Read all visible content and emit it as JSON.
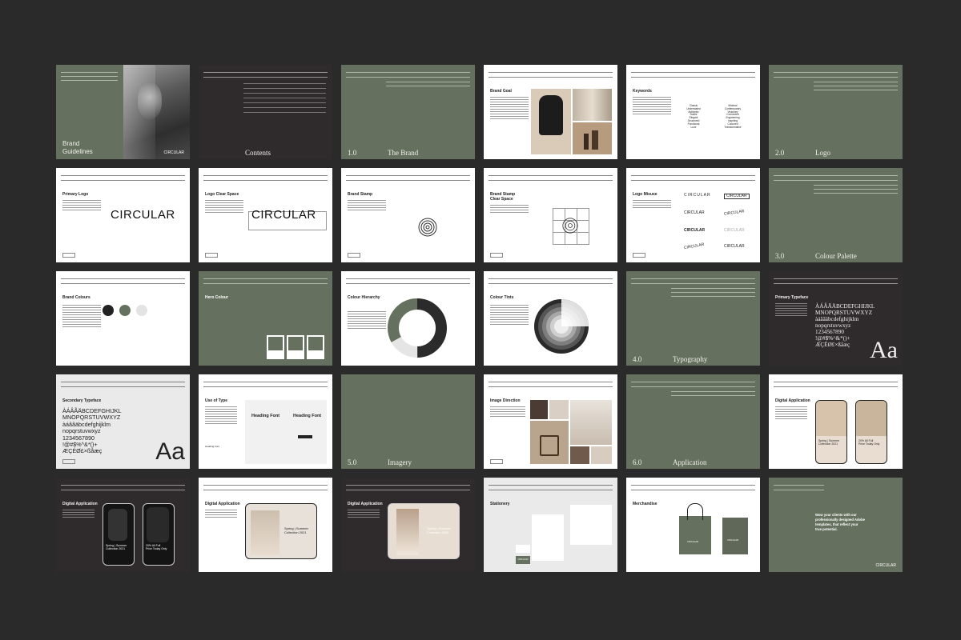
{
  "slides": {
    "cover": {
      "title_line1": "Brand",
      "title_line2": "Guidelines",
      "logo": "CIRCULAR"
    },
    "contents": {
      "title": "Contents"
    },
    "brand": {
      "num": "1.0",
      "name": "The Brand"
    },
    "brand_goal": {
      "title": "Brand Goal"
    },
    "keywords": {
      "title": "Keywords",
      "col1": "Classic\nUnderstated\nAuthentic\nSubtle\nElegant\nStructured\nFunctional\nLuxe",
      "col2": "Minimal\nContemporary\nVisionary\nConnected\nEngineering\nInspiring\nColoured\nTransformative"
    },
    "logo_section": {
      "num": "2.0",
      "name": "Logo"
    },
    "primary_logo": {
      "title": "Primary Logo",
      "logo": "CIRCULAR"
    },
    "logo_clear_space": {
      "title": "Logo Clear Space",
      "logo": "CIRCULAR"
    },
    "brand_stamp": {
      "title": "Brand Stamp"
    },
    "brand_stamp_clear": {
      "title_line1": "Brand Stamp",
      "title_line2": "Clear Space"
    },
    "logo_misuse": {
      "title": "Logo Misuse",
      "logo": "CIRCULAR"
    },
    "palette_section": {
      "num": "3.0",
      "name": "Colour Palette"
    },
    "brand_colours": {
      "title": "Brand Colours"
    },
    "hero_colour": {
      "title": "Hero Colour"
    },
    "colour_hierarchy": {
      "title": "Colour Hierarchy"
    },
    "colour_tints": {
      "title": "Colour Tints"
    },
    "typography_section": {
      "num": "4.0",
      "name": "Typography"
    },
    "primary_typeface": {
      "title": "Primary Typeface",
      "glyphs": "ÀÁÂÃÄBCDEFGHIJKL\nMNOPQRSTUVWXYZ\nàáâãäbcdefghijklm\nnopqrstuvwxyz\n1234567890\n!@#$%^&*()+\nÆÇÉØ£×ßåæç",
      "aa": "Aa"
    },
    "secondary_typeface": {
      "title": "Secondary Typeface",
      "glyphs": "ÀÁÂÃÄBCDEFGHIJKL\nMNOPQRSTUVWXYZ\nàáâãäbcdefghijklm\nnopqrstuvwxyz\n1234567890\n!@#$%^&*()+\nÆÇÉØ£×ßåæç",
      "aa": "Aa"
    },
    "use_of_type": {
      "title": "Use of Type",
      "heading1": "Heading Font",
      "heading2": "Heading Font",
      "label": "Heading Font"
    },
    "imagery_section": {
      "num": "5.0",
      "name": "Imagery"
    },
    "image_direction": {
      "title": "Image Direction"
    },
    "application_section": {
      "num": "6.0",
      "name": "Application"
    },
    "digital_app_1": {
      "title": "Digital Application",
      "promo1": "Spring | Summer\nCollection 2021",
      "promo2": "20% All Full\nPrice Today Only"
    },
    "digital_app_2": {
      "title": "Digital Application",
      "promo1": "Spring | Summer\nCollection 2021",
      "promo2": "20% All Full\nPrice Today Only"
    },
    "digital_app_3": {
      "title": "Digital Application",
      "promo": "Spring | Summer\nCollection 2021"
    },
    "digital_app_4": {
      "title": "Digital Application",
      "promo": "Spring | Summer\nCollection 2021"
    },
    "stationery": {
      "title": "Stationery",
      "logo": "CIRCULAR"
    },
    "merchandise": {
      "title": "Merchandise",
      "logo": "CIRCULAR"
    },
    "closing": {
      "text": "Wow your clients with our\nprofessionally designed Adobe\ntemplates, that reflect your\ntrue potential.",
      "logo": "CIRCULAR"
    }
  },
  "colors": {
    "background": "#2b2a2b",
    "green": "#66705f",
    "dark": "#2f2b2d",
    "white": "#ffffff"
  }
}
